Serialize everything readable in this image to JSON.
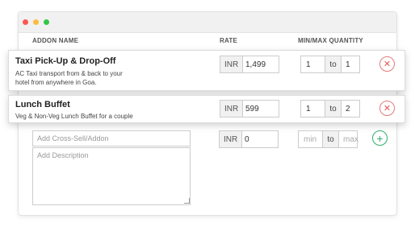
{
  "window": {
    "controls": [
      "close",
      "minimize",
      "maximize"
    ]
  },
  "table": {
    "headers": {
      "addon_name": "ADDON NAME",
      "rate": "RATE",
      "quantity": "MIN/MAX QUANTITY"
    }
  },
  "addons": [
    {
      "title": "Taxi Pick-Up & Drop-Off",
      "description_line1": "AC Taxi transport from & back to your",
      "description_line2": "hotel from anywhere in Goa.",
      "currency": "INR",
      "rate": "1,499",
      "min": "1",
      "to": "to",
      "max": "1",
      "remove_icon": "close-circle-icon"
    },
    {
      "title": "Lunch Buffet",
      "description_line1": "Veg & Non-Veg Lunch Buffet for a couple",
      "currency": "INR",
      "rate": "599",
      "min": "1",
      "to": "to",
      "max": "2",
      "remove_icon": "close-circle-icon"
    }
  ],
  "new_addon": {
    "name_placeholder": "Add Cross-Sell/Addon",
    "description_placeholder": "Add Description",
    "currency": "INR",
    "rate": "0",
    "min_placeholder": "min",
    "to": "to",
    "max_placeholder": "max",
    "add_icon": "plus-circle-icon"
  },
  "colors": {
    "remove": "#e05555",
    "add": "#2fae6e",
    "border": "#cccccc"
  }
}
